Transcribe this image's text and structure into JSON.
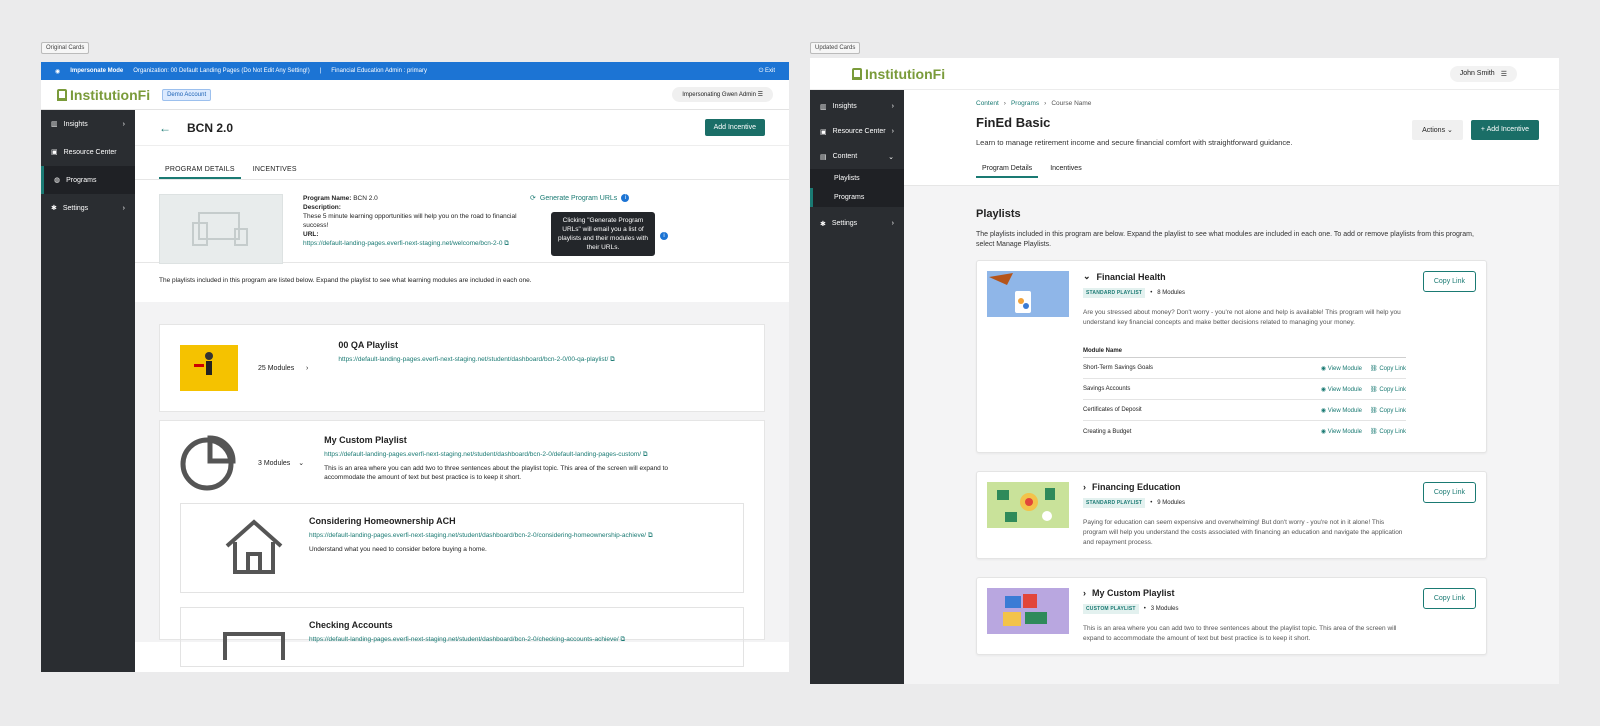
{
  "labels": {
    "original": "Original Cards",
    "updated": "Updated Cards"
  },
  "left": {
    "impersonate": {
      "mode": "Impersonate Mode",
      "org": "Organization: 00 Default Landing Pages (Do Not Edit Any Setting!)",
      "role": "Financial Education Admin : primary",
      "exit": "Exit"
    },
    "logo": "InstitutionFi",
    "demo": "Demo Account",
    "impuser": "Impersonating Gwen Admin",
    "nav": [
      "Insights",
      "Resource Center",
      "Programs",
      "Settings"
    ],
    "title": "BCN 2.0",
    "add": "Add Incentive",
    "tabs": [
      "PROGRAM DETAILS",
      "INCENTIVES"
    ],
    "pname_label": "Program Name:",
    "pname": "BCN 2.0",
    "desc_label": "Description:",
    "desc": "These 5 minute learning opportunities will help you on the road to financial success!",
    "url_label": "URL:",
    "url": "https://default-landing-pages.everfi-next-staging.net/welcome/bcn-2-0",
    "generate": "Generate Program URLs",
    "tooltip": "Clicking \"Generate Program URLs\" will email you a list of playlists and their modules with their URLs.",
    "listdesc": "The playlists included in this program are listed below. Expand the playlist to see what learning modules are included in each one.",
    "p1": {
      "mods": "25 Modules",
      "title": "00 QA Playlist",
      "url": "https://default-landing-pages.everfi-next-staging.net/student/dashboard/bcn-2-0/00-qa-playlist/"
    },
    "p2": {
      "mods": "3 Modules",
      "title": "My Custom Playlist",
      "url": "https://default-landing-pages.everfi-next-staging.net/student/dashboard/bcn-2-0/default-landing-pages-custom/",
      "text": "This is an area where you can add two to three sentences about the playlist topic. This area of the screen will expand to accommodate the amount of text but best practice is to keep it short."
    },
    "s1": {
      "title": "Considering Homeownership ACH",
      "url": "https://default-landing-pages.everfi-next-staging.net/student/dashboard/bcn-2-0/considering-homeownership-achieve/",
      "text": "Understand what you need to consider before buying a home."
    },
    "s2": {
      "title": "Checking Accounts",
      "url": "https://default-landing-pages.everfi-next-staging.net/student/dashboard/bcn-2-0/checking-accounts-achieve/"
    }
  },
  "right": {
    "logo": "InstitutionFi",
    "user": "John Smith",
    "nav": [
      "Insights",
      "Resource Center",
      "Content",
      "Playlists",
      "Programs",
      "Settings"
    ],
    "bc": [
      "Content",
      "Programs",
      "Course Name"
    ],
    "title": "FinEd Basic",
    "sub": "Learn to manage retirement income and secure financial comfort with straightforward guidance.",
    "actions": "Actions",
    "add": "+ Add Incentive",
    "tabs": [
      "Program Details",
      "Incentives"
    ],
    "h2": "Playlists",
    "desc": "The playlists included in this program are below. Expand the playlist to see what modules are included in each one. To add or remove playlists from this program, select Manage Playlists.",
    "copy": "Copy Link",
    "c1": {
      "title": "Financial Health",
      "badge": "STANDARD PLAYLIST",
      "mods": "8 Modules",
      "text": "Are you stressed about money? Don't worry - you're not alone and help is available! This program will help you understand key financial concepts and make better decisions related to managing your money.",
      "mhead": "Module Name",
      "rows": [
        "Short-Term Savings Goals",
        "Savings Accounts",
        "Certificates of Deposit",
        "Creating a Budget"
      ],
      "view": "View Module",
      "copy": "Copy Link"
    },
    "c2": {
      "title": "Financing Education",
      "badge": "STANDARD PLAYLIST",
      "mods": "9 Modules",
      "text": "Paying for education can seem expensive and overwhelming! But don't worry - you're not in it alone! This program will help you understand the costs associated with financing an education and navigate the application and repayment process."
    },
    "c3": {
      "title": "My Custom Playlist",
      "badge": "CUSTOM PLAYLIST",
      "mods": "3 Modules",
      "text": "This is an area where you can add two to three sentences about the playlist topic. This area of the screen will expand to accommodate the amount of text but best practice is to keep it short."
    }
  }
}
